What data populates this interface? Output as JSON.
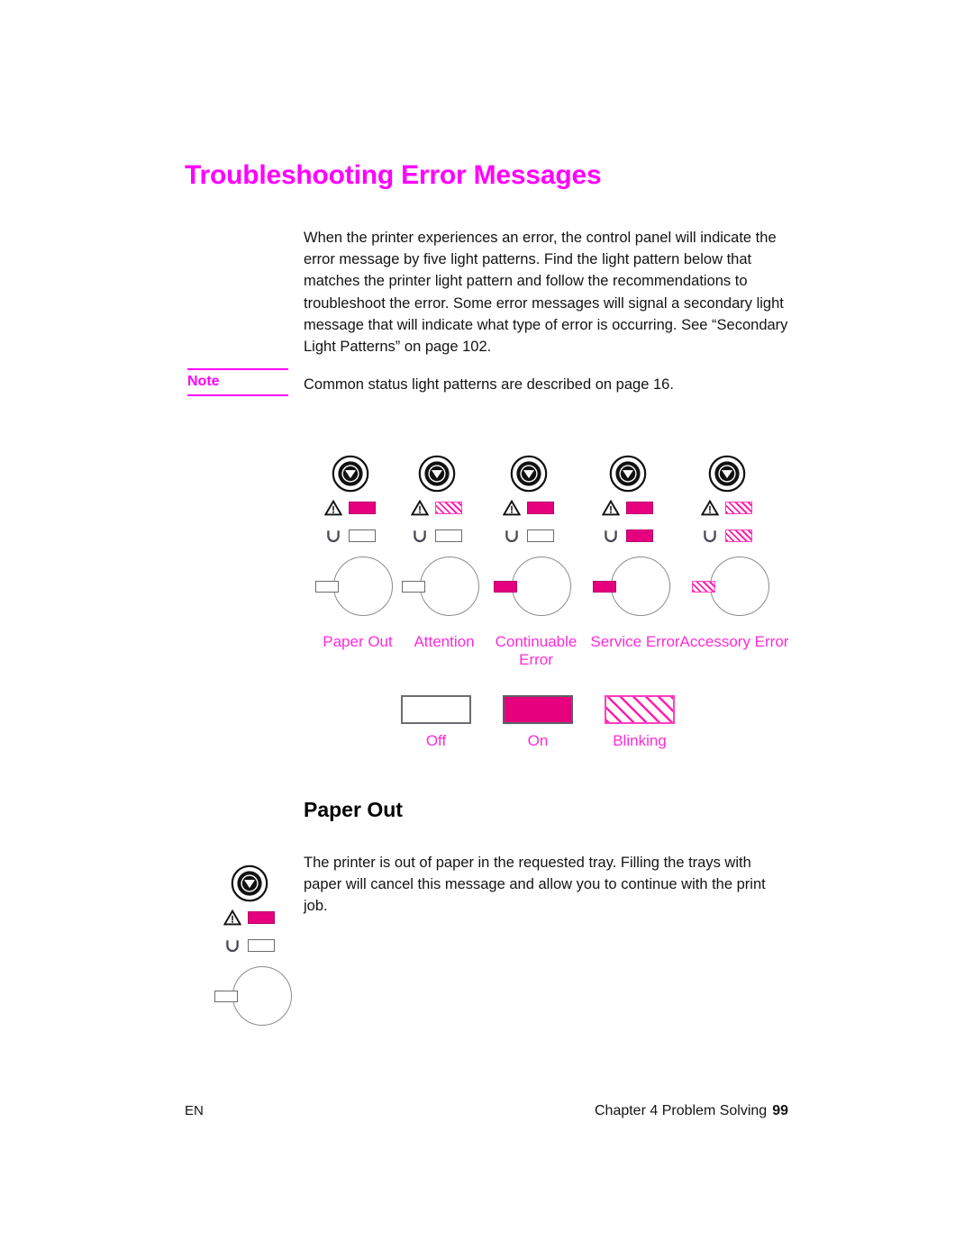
{
  "document": {
    "title": "Troubleshooting Error Messages",
    "intro": "When the printer experiences an error, the control panel will indicate the error message by five light patterns. Find the light pattern below that matches the printer light pattern and follow the recommendations to troubleshoot the error. Some error messages will signal a secondary light message that will indicate what type of error is occurring. See “Secondary Light Patterns” on page 102."
  },
  "note": {
    "label": "Note",
    "text": "Common status light patterns are described on page 16."
  },
  "colors": {
    "title_magenta": "#FF00FF",
    "label_magenta": "#FF2BD6",
    "led_on": "#E6007E",
    "led_blink_stripe": "#FF1FAE",
    "outline_gray": "#6b6b72",
    "body_text": "#141414"
  },
  "light_patterns": {
    "panels": [
      {
        "caption": "Paper Out",
        "button_icon": "printer-go-button-icon",
        "attention_light": "on",
        "ready_light": "off",
        "tray_indicator": "off"
      },
      {
        "caption": "Attention",
        "button_icon": "printer-go-button-icon",
        "attention_light": "blinking",
        "ready_light": "off",
        "tray_indicator": "off"
      },
      {
        "caption": "Continuable Error",
        "button_icon": "printer-go-button-icon",
        "attention_light": "on",
        "ready_light": "off",
        "tray_indicator": "on"
      },
      {
        "caption": "Service Error",
        "button_icon": "printer-go-button-icon",
        "attention_light": "on",
        "ready_light": "on",
        "tray_indicator": "on"
      },
      {
        "caption": "Accessory Error",
        "button_icon": "printer-go-button-icon",
        "attention_light": "blinking",
        "ready_light": "blinking",
        "tray_indicator": "blinking"
      }
    ]
  },
  "legend": {
    "items": [
      {
        "state": "off",
        "label": "Off"
      },
      {
        "state": "on",
        "label": "On"
      },
      {
        "state": "blinking",
        "label": "Blinking"
      }
    ]
  },
  "section": {
    "heading": "Paper Out",
    "body": "The printer is out of paper in the requested tray. Filling the trays with paper will cancel this message and allow you to continue with the print job.",
    "figure": {
      "button_icon": "printer-go-button-icon",
      "attention_light": "on",
      "ready_light": "off",
      "tray_indicator": "off"
    }
  },
  "footer": {
    "left": "EN",
    "chapter": "Chapter 4 Problem Solving",
    "page_number": "99"
  }
}
